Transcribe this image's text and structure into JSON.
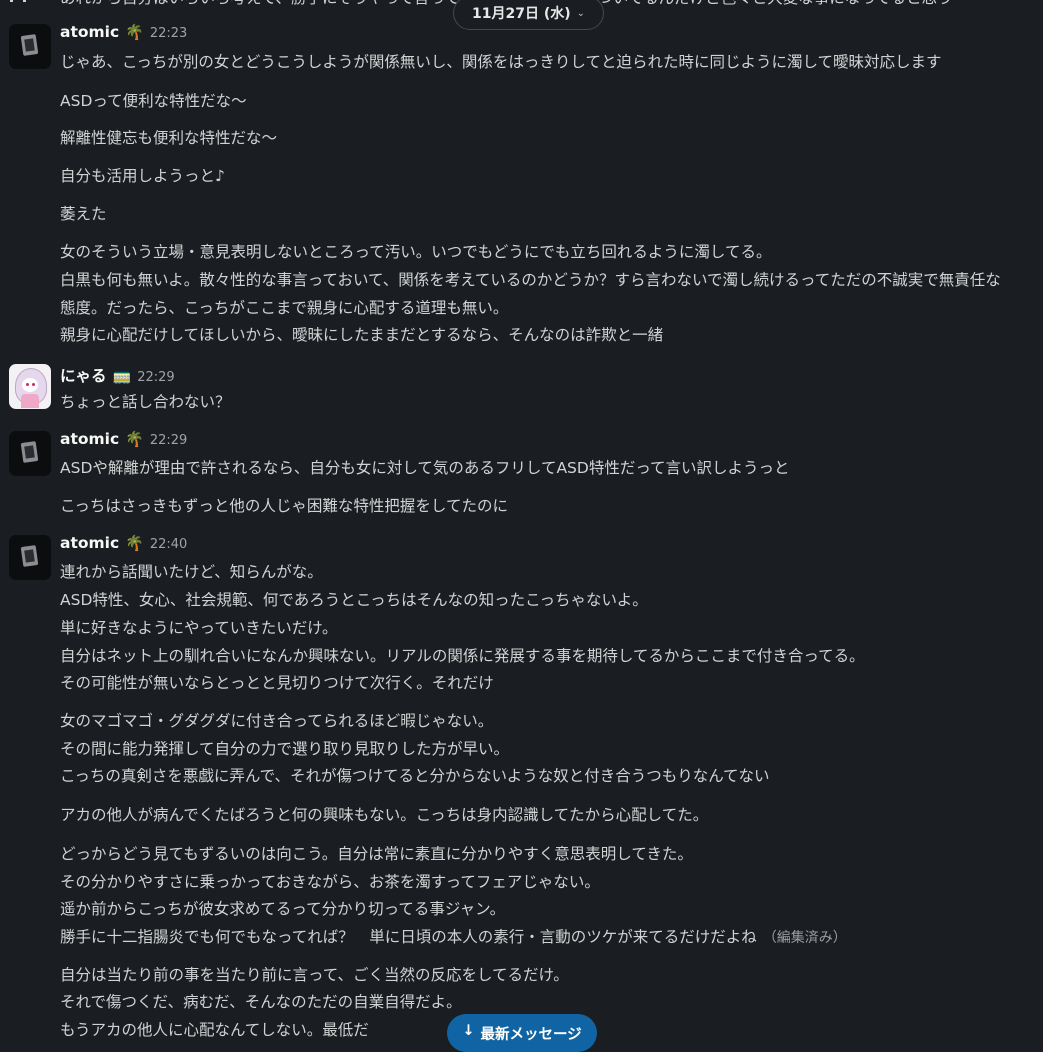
{
  "date_divider": {
    "label": "11月27日 (水)",
    "chevron": "⌄"
  },
  "clipped_top_text": "あれから自分はいろいろ考えて、勝手にそうやって言ってきたのにこっちも傷ついてるんだけど色々と大変な事になってると思う",
  "messages": [
    {
      "author": "atomic",
      "emoji": "🌴",
      "time": "22:23",
      "avatar": "atomic",
      "lines": [
        "じゃあ、こっちが別の女とどうこうしようが関係無いし、関係をはっきりしてと迫られた時に同じように濁して曖昧対応します",
        "ASDって便利な特性だな〜",
        "解離性健忘も便利な特性だな〜",
        "自分も活用しようっと♪",
        "萎えた",
        "女のそういう立場・意見表明しないところって汚い。いつでもどうにでも立ち回れるように濁してる。",
        "白黒も何も無いよ。散々性的な事言っておいて、関係を考えているのかどうか？すら言わないで濁し続けるってただの不誠実で無責任な",
        "態度。だったら、こっちがここまで親身に心配する道理も無い。",
        "親身に心配だけしてほしいから、曖昧にしたままだとするなら、そんなのは詐欺と一緒"
      ]
    },
    {
      "author": "にゃる",
      "emoji": "🚃",
      "time": "22:29",
      "avatar": "nyaru",
      "lines": [
        "ちょっと話し合わない？"
      ]
    },
    {
      "author": "atomic",
      "emoji": "🌴",
      "time": "22:29",
      "avatar": "atomic",
      "lines": [
        "ASDや解離が理由で許されるなら、自分も女に対して気のあるフリしてASD特性だって言い訳しようっと",
        "こっちはさっきもずっと他の人じゃ困難な特性把握をしてたのに"
      ]
    },
    {
      "author": "atomic",
      "emoji": "🌴",
      "time": "22:40",
      "avatar": "atomic",
      "lines": [
        "連れから話聞いたけど、知らんがな。",
        "ASD特性、女心、社会規範、何であろうとこっちはそんなの知ったこっちゃないよ。",
        "単に好きなようにやっていきたいだけ。",
        "自分はネット上の馴れ合いになんか興味ない。リアルの関係に発展する事を期待してるからここまで付き合ってる。",
        "その可能性が無いならとっとと見切りつけて次行く。それだけ",
        "女のマゴマゴ・グダグダに付き合ってられるほど暇じゃない。",
        "その間に能力発揮して自分の力で選り取り見取りした方が早い。",
        "こっちの真剣さを悪戯に弄んで、それが傷つけてると分からないような奴と付き合うつもりなんてない",
        "アカの他人が病んでくたばろうと何の興味もない。こっちは身内認識してたから心配してた。",
        "どっからどう見てもずるいのは向こう。自分は常に素直に分かりやすく意思表明してきた。",
        "その分かりやすさに乗っかっておきながら、お茶を濁すってフェアじゃない。",
        "遥か前からこっちが彼女求めてるって分かり切ってる事ジャン。",
        "勝手に十二指腸炎でも何でもなってれば？　単に日頃の本人の素行・言動のツケが来てるだけだよね",
        "自分は当たり前の事を当たり前に言って、ごく当然の反応をしてるだけ。",
        "それで傷つくだ、病むだ、そんなのただの自業自得だよ。",
        "もうアカの他人に心配なんてしない。最低だ"
      ],
      "edited_label": "（編集済み）"
    }
  ],
  "latest_button": {
    "label": "最新メッセージ",
    "arrow": "↓"
  }
}
